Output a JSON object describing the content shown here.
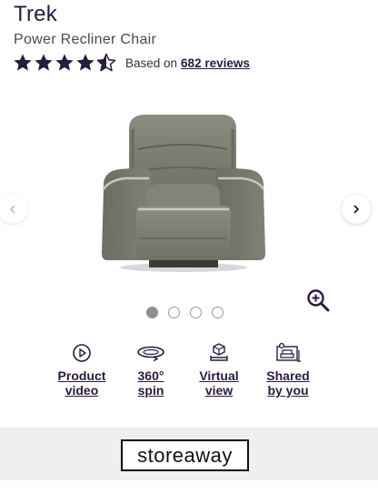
{
  "product": {
    "title": "Trek",
    "subtitle": "Power Recliner Chair"
  },
  "rating": {
    "stars": 4.5,
    "max_stars": 5,
    "star_color": "#2a1a3f",
    "prefix": "Based on",
    "review_link": "682 reviews"
  },
  "gallery": {
    "current_image": 1,
    "image_count": 4,
    "prev_icon": "chevron-left-icon",
    "next_icon": "chevron-right-icon",
    "zoom_icon": "zoom-in-icon"
  },
  "features": [
    {
      "line1": "Product",
      "line2": "video",
      "icon": "play-icon"
    },
    {
      "line1": "360°",
      "line2": "spin",
      "icon": "rotate-360-icon"
    },
    {
      "line1": "Virtual",
      "line2": "view",
      "icon": "ar-cube-icon"
    },
    {
      "line1": "Shared",
      "line2": "by you",
      "icon": "photo-sofa-icon"
    }
  ],
  "banner": {
    "logo_text": "storeaway"
  }
}
